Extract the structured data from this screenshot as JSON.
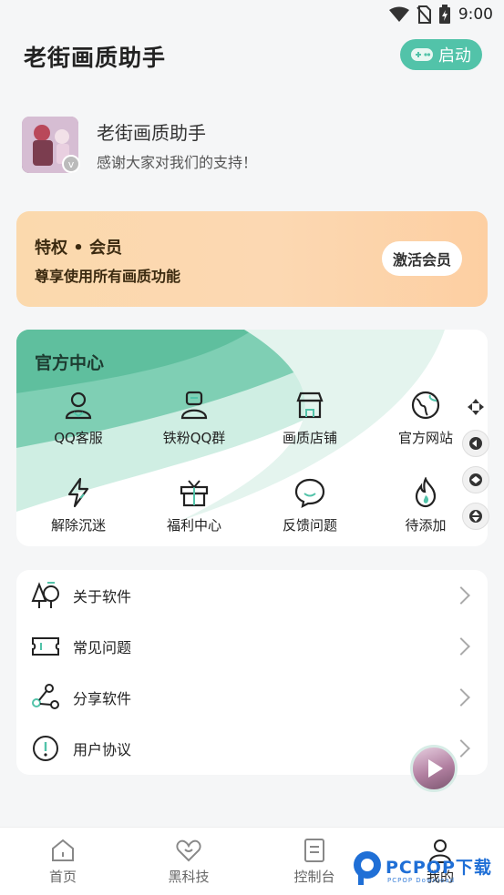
{
  "status_bar": {
    "time": "9:00",
    "icons": [
      "wifi-icon",
      "no-sim-icon",
      "battery-charging-icon"
    ]
  },
  "header": {
    "title": "老街画质助手",
    "launch_label": "启动",
    "launch_icon": "gamepad-icon",
    "accent_color": "#52c3a9"
  },
  "profile": {
    "name": "老街画质助手",
    "motto": "感谢大家对我们的支持！"
  },
  "vip": {
    "title": "特权 • 会员",
    "subtitle": "尊享使用所有画质功能",
    "button_label": "激活会员"
  },
  "official": {
    "title": "官方中心",
    "items": [
      {
        "label": "QQ客服",
        "icon": "user-icon"
      },
      {
        "label": "铁粉QQ群",
        "icon": "user-group-icon"
      },
      {
        "label": "画质店铺",
        "icon": "store-icon"
      },
      {
        "label": "官方网站",
        "icon": "globe-icon"
      },
      {
        "label": "解除沉迷",
        "icon": "lightning-icon"
      },
      {
        "label": "福利中心",
        "icon": "gift-icon"
      },
      {
        "label": "反馈问题",
        "icon": "chat-bubble-icon"
      },
      {
        "label": "待添加",
        "icon": "flame-icon"
      }
    ]
  },
  "menu": {
    "items": [
      {
        "label": "关于软件",
        "icon": "trees-icon"
      },
      {
        "label": "常见问题",
        "icon": "ticket-icon"
      },
      {
        "label": "分享软件",
        "icon": "share-icon"
      },
      {
        "label": "用户协议",
        "icon": "alert-circle-icon"
      }
    ]
  },
  "tabbar": {
    "tabs": [
      {
        "label": "首页",
        "icon": "home-icon"
      },
      {
        "label": "黑科技",
        "icon": "heart-icon"
      },
      {
        "label": "控制台",
        "icon": "document-icon"
      },
      {
        "label": "我的",
        "icon": "profile-icon"
      }
    ],
    "active_index": 3
  },
  "watermark": {
    "text": "PCPOP下载",
    "small_text": "PCPOP Download"
  }
}
